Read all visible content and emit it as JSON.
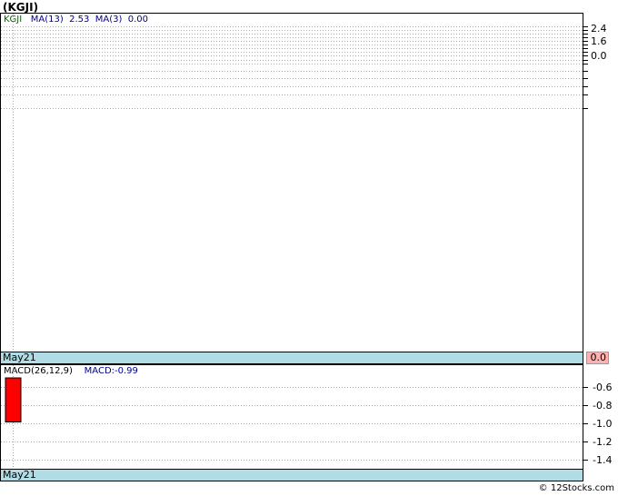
{
  "title": "(KGJI)",
  "price_panel": {
    "symbol": "KGJI",
    "ma13_label": "MA(13)",
    "ma13_value": "2.53",
    "ma3_label": "MA(3)",
    "ma3_value": "0.00",
    "date_label": "May21",
    "last_value": "0.0",
    "colors": {
      "symbol": "#006400",
      "ma": "#00008b",
      "last_box": "#ffb0b0",
      "date_bar": "#b0dce6"
    }
  },
  "macd_panel": {
    "label": "MACD(26,12,9)",
    "macd_text": "MACD:-0.99",
    "date_label": "May21",
    "colors": {
      "bar": "#ff0000",
      "text": "#00008b"
    }
  },
  "footer": "© 12Stocks.com",
  "chart_data": [
    {
      "type": "line",
      "name": "price",
      "y_ticks": [
        "2.4",
        "1.6",
        "0.0"
      ],
      "series": [],
      "grid": true
    },
    {
      "type": "bar",
      "name": "macd",
      "categories": [
        "May21"
      ],
      "values": [
        -0.99
      ],
      "y_ticks": [
        "-0.6",
        "-0.8",
        "-1.0",
        "-1.2",
        "-1.4"
      ],
      "ylim": [
        -1.5,
        -0.5
      ],
      "grid": true
    }
  ]
}
